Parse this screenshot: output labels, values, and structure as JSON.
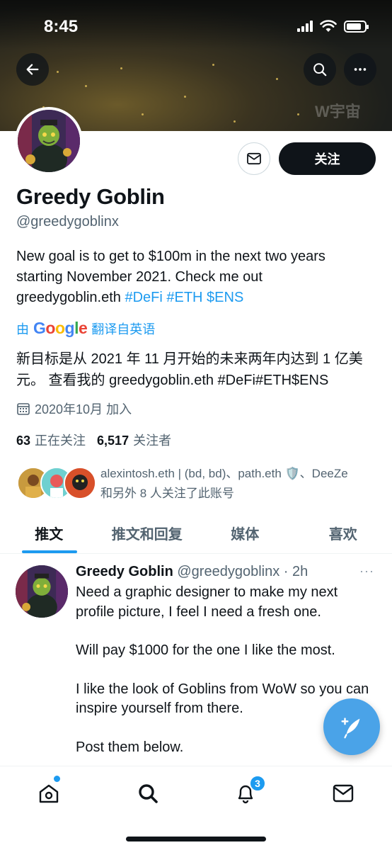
{
  "status_bar": {
    "time": "8:45"
  },
  "banner": {
    "watermark": "W宇宙"
  },
  "profile": {
    "name": "Greedy Goblin",
    "handle": "@greedygoblinx",
    "follow_label": "关注",
    "bio_line1": "New goal is to get to $100m in the next two years",
    "bio_line2": "starting November 2021. Check me out",
    "bio_link": "greedygoblin.eth",
    "bio_tags": "#DeFi #ETH $ENS",
    "translate_prefix": "由",
    "translate_logo": "Google",
    "translate_suffix": "翻译自英语",
    "bio_translated": "新目标是从 2021 年 11 月开始的未来两年内达到 1 亿美元。 查看我的 greedygoblin.eth #DeFi#ETH$ENS",
    "joined": "2020年10月 加入",
    "following_count": "63",
    "following_label": "正在关注",
    "followers_count": "6,517",
    "followers_label": "关注者",
    "followed_by_line1": "alexintosh.eth | (bd, bd)、path.eth 🛡️、DeeZe",
    "followed_by_line2": "和另外 8 人关注了此账号"
  },
  "tabs": [
    {
      "label": "推文"
    },
    {
      "label": "推文和回复"
    },
    {
      "label": "媒体"
    },
    {
      "label": "喜欢"
    }
  ],
  "tweet": {
    "name": "Greedy Goblin",
    "handle_time": "@greedygoblinx · 2h",
    "more": "···",
    "paragraphs": [
      "Need a graphic designer to make my next profile picture, I feel I need a fresh one.",
      "Will pay $1000 for the one I like the most.",
      "I like the look of Goblins from WoW so you can inspire yourself from there.",
      "Post them below."
    ]
  },
  "bottom_nav": {
    "notifications_badge": "3"
  },
  "colors": {
    "accent": "#1d9bf0",
    "text": "#0f1419",
    "secondary": "#536471",
    "fab": "#4aa3e8"
  }
}
